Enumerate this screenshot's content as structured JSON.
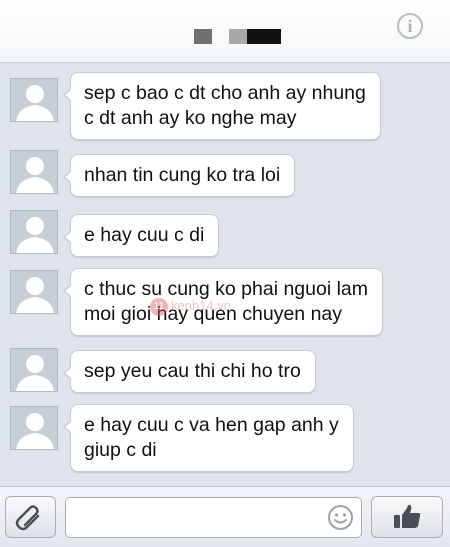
{
  "header": {
    "contact_name": "",
    "info_icon": "info-icon",
    "info_glyph": "i"
  },
  "messages": [
    {
      "avatar_icon": "default-avatar-icon",
      "lines": [
        "sep c bao c dt cho anh ay nhung",
        "c dt anh ay ko nghe may"
      ]
    },
    {
      "avatar_icon": "default-avatar-icon",
      "lines": [
        "nhan tin cung ko tra loi"
      ]
    },
    {
      "avatar_icon": "default-avatar-icon",
      "lines": [
        "e hay cuu c di"
      ]
    },
    {
      "avatar_icon": "default-avatar-icon",
      "lines": [
        "c thuc su cung ko phai nguoi lam",
        "moi gioi hay quen chuyen nay"
      ]
    },
    {
      "avatar_icon": "default-avatar-icon",
      "lines": [
        "sep yeu cau thi chi ho tro"
      ]
    },
    {
      "avatar_icon": "default-avatar-icon",
      "lines": [
        "e hay cuu c va hen gap anh y",
        "giup c di"
      ]
    }
  ],
  "watermark": {
    "badge": "11",
    "text": "kenh14.vn"
  },
  "composer": {
    "attach_icon": "paperclip-icon",
    "input_value": "",
    "emoji_icon": "smiley-icon",
    "like_icon": "thumbs-up-icon"
  },
  "colors": {
    "background": "#dfe3ec",
    "bubble": "#ffffff",
    "avatar": "#c6ced8",
    "header": "#f4f5f8"
  }
}
